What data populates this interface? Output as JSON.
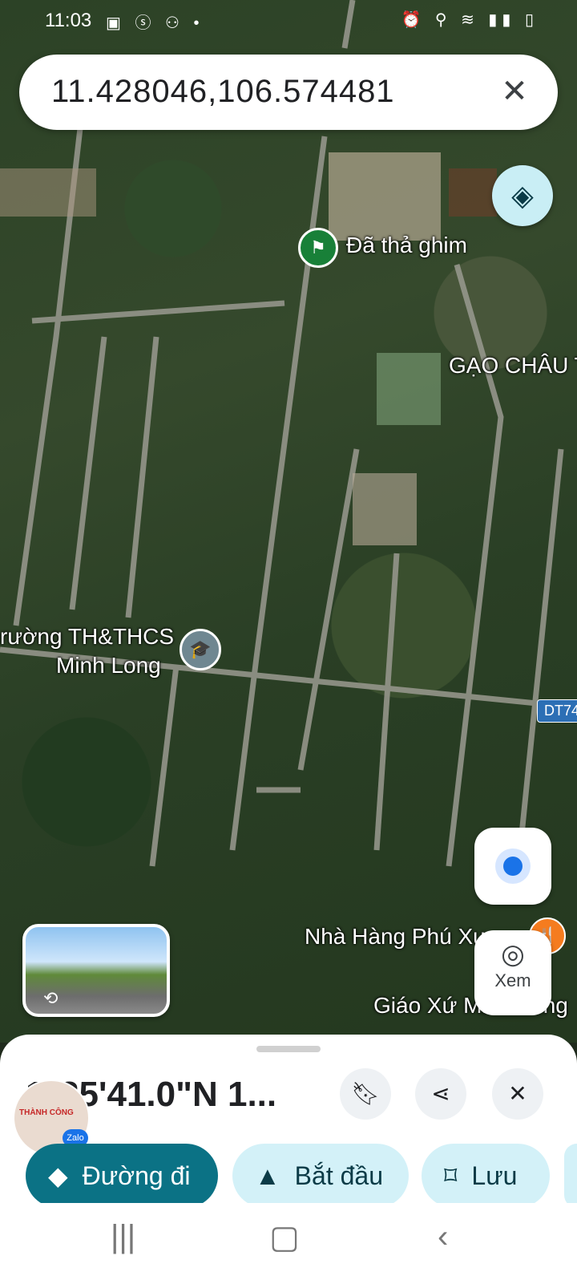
{
  "status_bar": {
    "time": "11:03",
    "left_icons": [
      "gallery-icon",
      "shop-icon",
      "user-icon",
      "dot-icon"
    ],
    "right_icons": [
      "alarm-icon",
      "location-icon",
      "wifi-icon",
      "signal-icon",
      "battery-icon"
    ]
  },
  "search": {
    "query": "11.428046,106.574481"
  },
  "map": {
    "labels": {
      "dropped_pin": "Đã thả ghim",
      "gao_chau": "GẠO CHÂU T",
      "school_line1": "rường TH&THCS",
      "school_line2": "Minh Long",
      "road_badge": "DT74",
      "restaurant": "Nhà Hàng Phú Xu",
      "church": "Giáo Xứ Minh Long"
    },
    "xem_label": "Xem"
  },
  "sheet": {
    "coords": "1°25'41.0\"N 1...",
    "actions": {
      "directions": "Đường đi",
      "start": "Bắt đầu",
      "save": "Lưu"
    },
    "avatar_text": "THÀNH CÔNG",
    "zalo_label": "Zalo"
  },
  "colors": {
    "primary_action": "#0b7285",
    "secondary_action": "#d3f1f8",
    "pin": "#188038"
  }
}
